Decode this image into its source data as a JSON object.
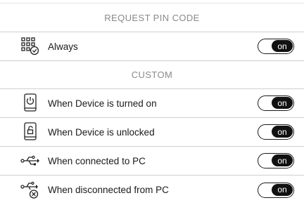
{
  "sections": {
    "request_pin": {
      "title": "REQUEST PIN CODE"
    },
    "custom": {
      "title": "CUSTOM"
    }
  },
  "rows": [
    {
      "label": "Always",
      "icon": "keypad-check-icon",
      "state": "on"
    },
    {
      "label": "When Device is turned on",
      "icon": "device-power-icon",
      "state": "on"
    },
    {
      "label": "When Device is unlocked",
      "icon": "device-unlock-icon",
      "state": "on"
    },
    {
      "label": "When connected to PC",
      "icon": "usb-icon",
      "state": "on"
    },
    {
      "label": "When disconnected from PC",
      "icon": "usb-disconnect-icon",
      "state": "on"
    }
  ]
}
